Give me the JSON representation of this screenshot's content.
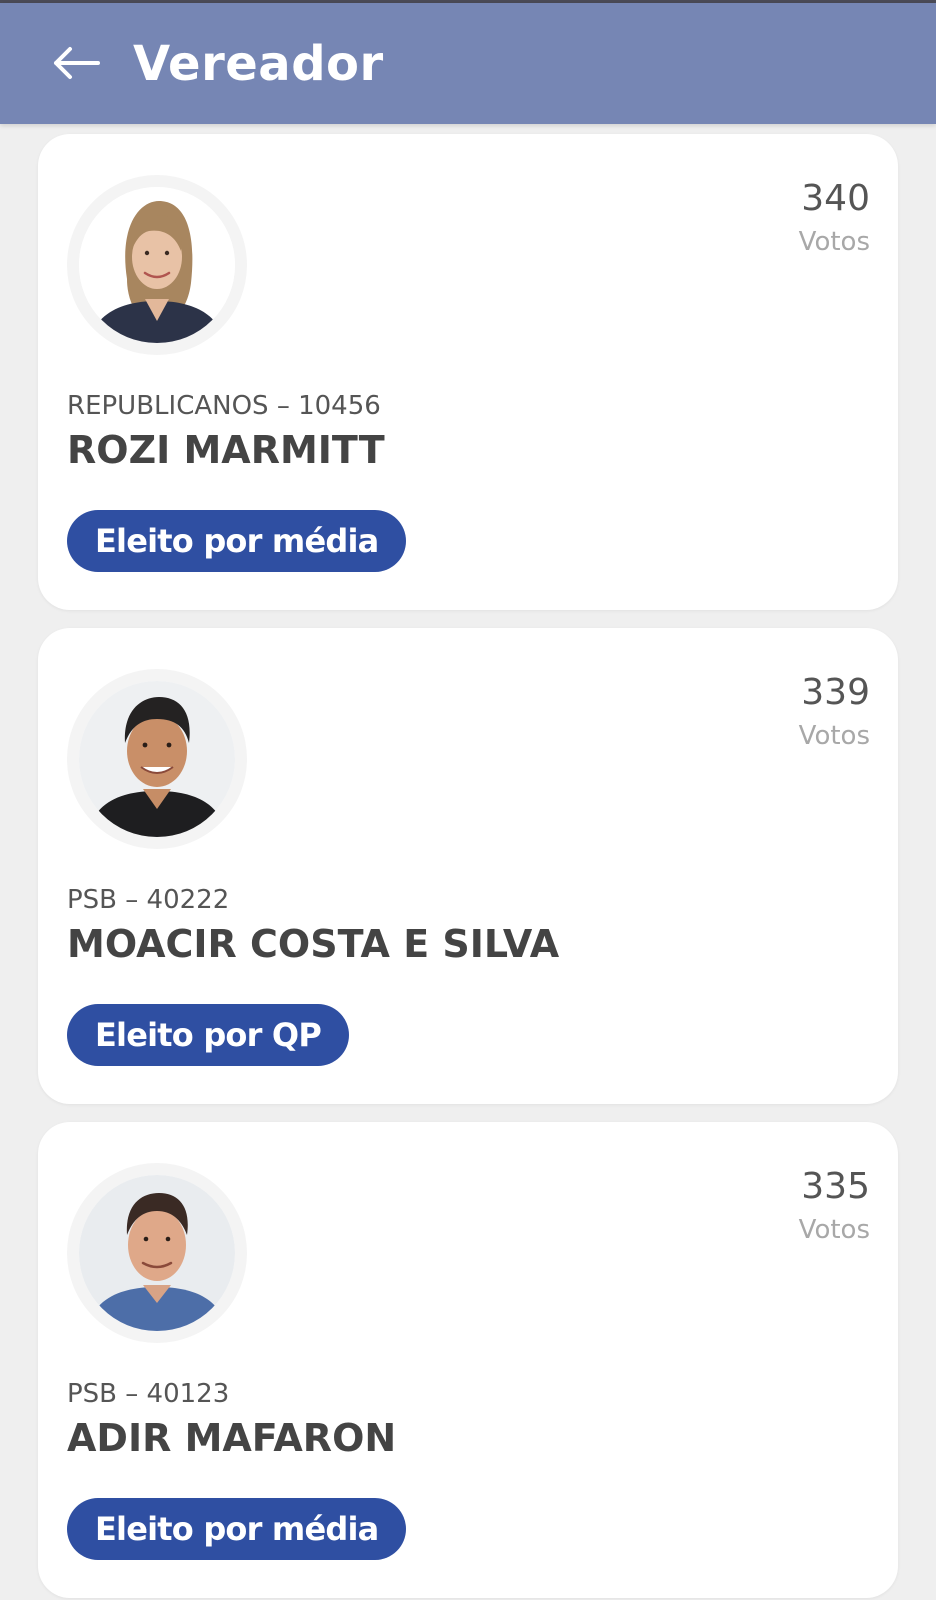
{
  "header": {
    "back_icon": "arrow-left-icon",
    "title": "Vereador"
  },
  "colors": {
    "appbar": "#7686b4",
    "badge": "#2f4fa2",
    "background": "#efefef"
  },
  "candidates": [
    {
      "party_number": "REPUBLICANOS – 10456",
      "name": "ROZI MARMITT",
      "votes": "340",
      "votes_label": "Votos",
      "status": "Eleito por média"
    },
    {
      "party_number": "PSB – 40222",
      "name": "MOACIR COSTA E SILVA",
      "votes": "339",
      "votes_label": "Votos",
      "status": "Eleito por QP"
    },
    {
      "party_number": "PSB – 40123",
      "name": "ADIR MAFARON",
      "votes": "335",
      "votes_label": "Votos",
      "status": "Eleito por média"
    }
  ]
}
